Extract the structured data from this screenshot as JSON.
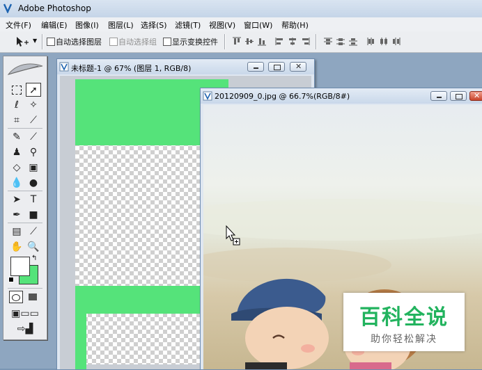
{
  "app": {
    "title": "Adobe Photoshop"
  },
  "menu": [
    "文件(F)",
    "编辑(E)",
    "图像(I)",
    "图层(L)",
    "选择(S)",
    "滤镜(T)",
    "视图(V)",
    "窗口(W)",
    "帮助(H)"
  ],
  "options": {
    "auto_select_layer": "自动选择图层",
    "auto_select_group": "自动选择组",
    "show_transform": "显示变换控件"
  },
  "doc1": {
    "title": "未标题-1 @ 67% (图层 1, RGB/8)"
  },
  "doc2": {
    "title": "20120909_0.jpg @ 66.7%(RGB/8#)"
  },
  "colors": {
    "foreground": "#ffffff",
    "background": "#55e37a",
    "canvas_green": "#55e37a"
  },
  "watermark": {
    "title": "百科全说",
    "subtitle": "助你轻松解决"
  }
}
